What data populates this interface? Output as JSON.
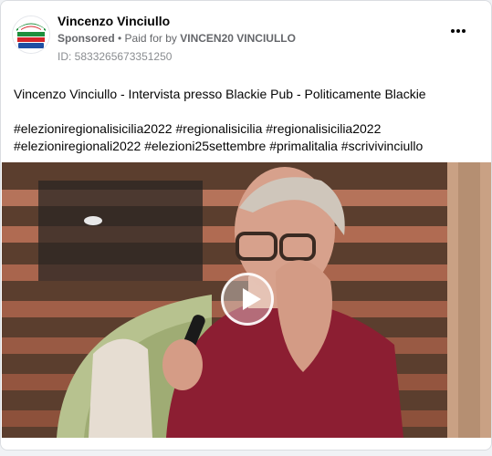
{
  "post": {
    "author": "Vincenzo Vinciullo",
    "sponsored_label": "Sponsored",
    "separator": " • ",
    "paid_for_prefix": "Paid for by ",
    "paid_for_name": "VINCEN20 VINCIULLO",
    "ad_id": "ID: 5833265673351250",
    "title_line": "Vincenzo Vinciullo - Intervista presso Blackie Pub - Politicamente Blackie",
    "hashtags_line1": "#elezioniregionalisicilia2022 #regionalisicilia #regionalisicilia2022",
    "hashtags_line2": "#elezioniregionali2022 #elezioni25settembre #primalitalia #scrivivinciullo"
  },
  "colors": {
    "text_primary": "#050505",
    "text_secondary": "#65676b",
    "card_border": "#dadde1",
    "logo_green": "#1e8f3c",
    "logo_red": "#d6262b"
  },
  "icons": {
    "more": "more-horizontal-icon",
    "play": "play-icon"
  }
}
